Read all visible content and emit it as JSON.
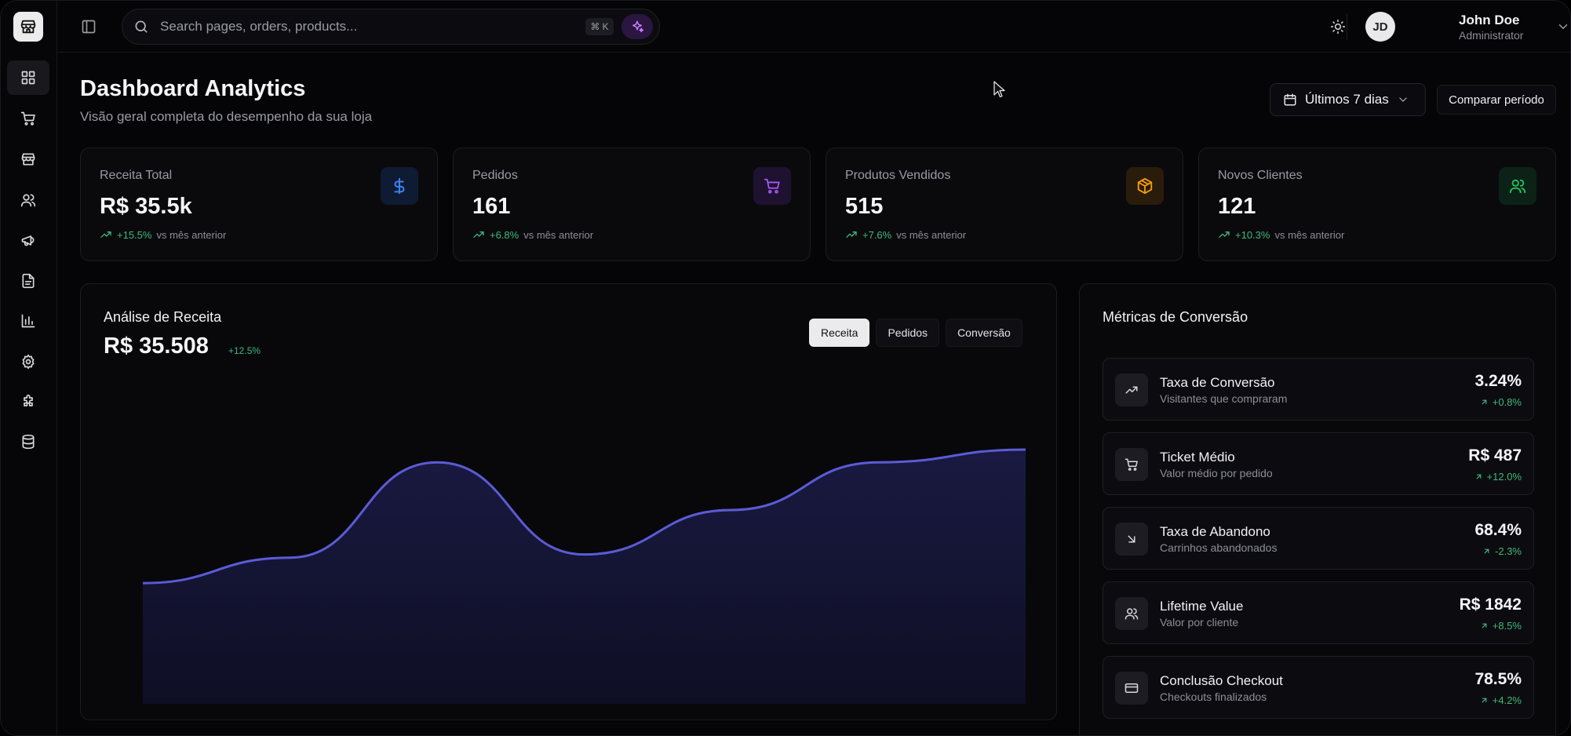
{
  "search": {
    "placeholder": "Search pages, orders, products...",
    "shortcut": "⌘ K"
  },
  "user": {
    "initials": "JD",
    "name": "John Doe",
    "role": "Administrator"
  },
  "header": {
    "title": "Dashboard Analytics",
    "subtitle": "Visão geral completa do desempenho da sua loja"
  },
  "range": {
    "label": "Últimos 7 dias"
  },
  "compare": {
    "label": "Comparar período"
  },
  "stats": [
    {
      "label": "Receita Total",
      "value": "R$ 35.5k",
      "change": "+15.5%",
      "vs": "vs mês anterior",
      "icon": "dollar-icon",
      "color": "#3b82f6"
    },
    {
      "label": "Pedidos",
      "value": "161",
      "change": "+6.8%",
      "vs": "vs mês anterior",
      "icon": "cart-icon",
      "color": "#a855f7"
    },
    {
      "label": "Produtos Vendidos",
      "value": "515",
      "change": "+7.6%",
      "vs": "vs mês anterior",
      "icon": "package-icon",
      "color": "#f59e0b"
    },
    {
      "label": "Novos Clientes",
      "value": "121",
      "change": "+10.3%",
      "vs": "vs mês anterior",
      "icon": "users-icon",
      "color": "#22c55e"
    }
  ],
  "revenue": {
    "title": "Análise de Receita",
    "value": "R$ 35.508",
    "change": "+12.5%",
    "tabs": [
      "Receita",
      "Pedidos",
      "Conversão"
    ],
    "active_tab": "Receita"
  },
  "chart_data": {
    "type": "area",
    "x_index": [
      0,
      1,
      2,
      3,
      4,
      5,
      6
    ],
    "values": [
      3.8,
      4.6,
      7.6,
      4.7,
      6.1,
      7.6,
      8.0
    ],
    "ylim": [
      0,
      10
    ],
    "grid": false,
    "color": "#5b5bd6"
  },
  "conversion": {
    "title": "Métricas de Conversão",
    "metrics": [
      {
        "name": "Taxa de Conversão",
        "desc": "Visitantes que compraram",
        "value": "3.24%",
        "change": "+0.8%",
        "icon": "trending-up-icon"
      },
      {
        "name": "Ticket Médio",
        "desc": "Valor médio por pedido",
        "value": "R$ 487",
        "change": "+12.0%",
        "icon": "cart-icon"
      },
      {
        "name": "Taxa de Abandono",
        "desc": "Carrinhos abandonados",
        "value": "68.4%",
        "change": "-2.3%",
        "icon": "arrow-down-right-icon"
      },
      {
        "name": "Lifetime Value",
        "desc": "Valor por cliente",
        "value": "R$ 1842",
        "change": "+8.5%",
        "icon": "users-icon"
      },
      {
        "name": "Conclusão Checkout",
        "desc": "Checkouts finalizados",
        "value": "78.5%",
        "change": "+4.2%",
        "icon": "credit-card-icon"
      }
    ]
  }
}
